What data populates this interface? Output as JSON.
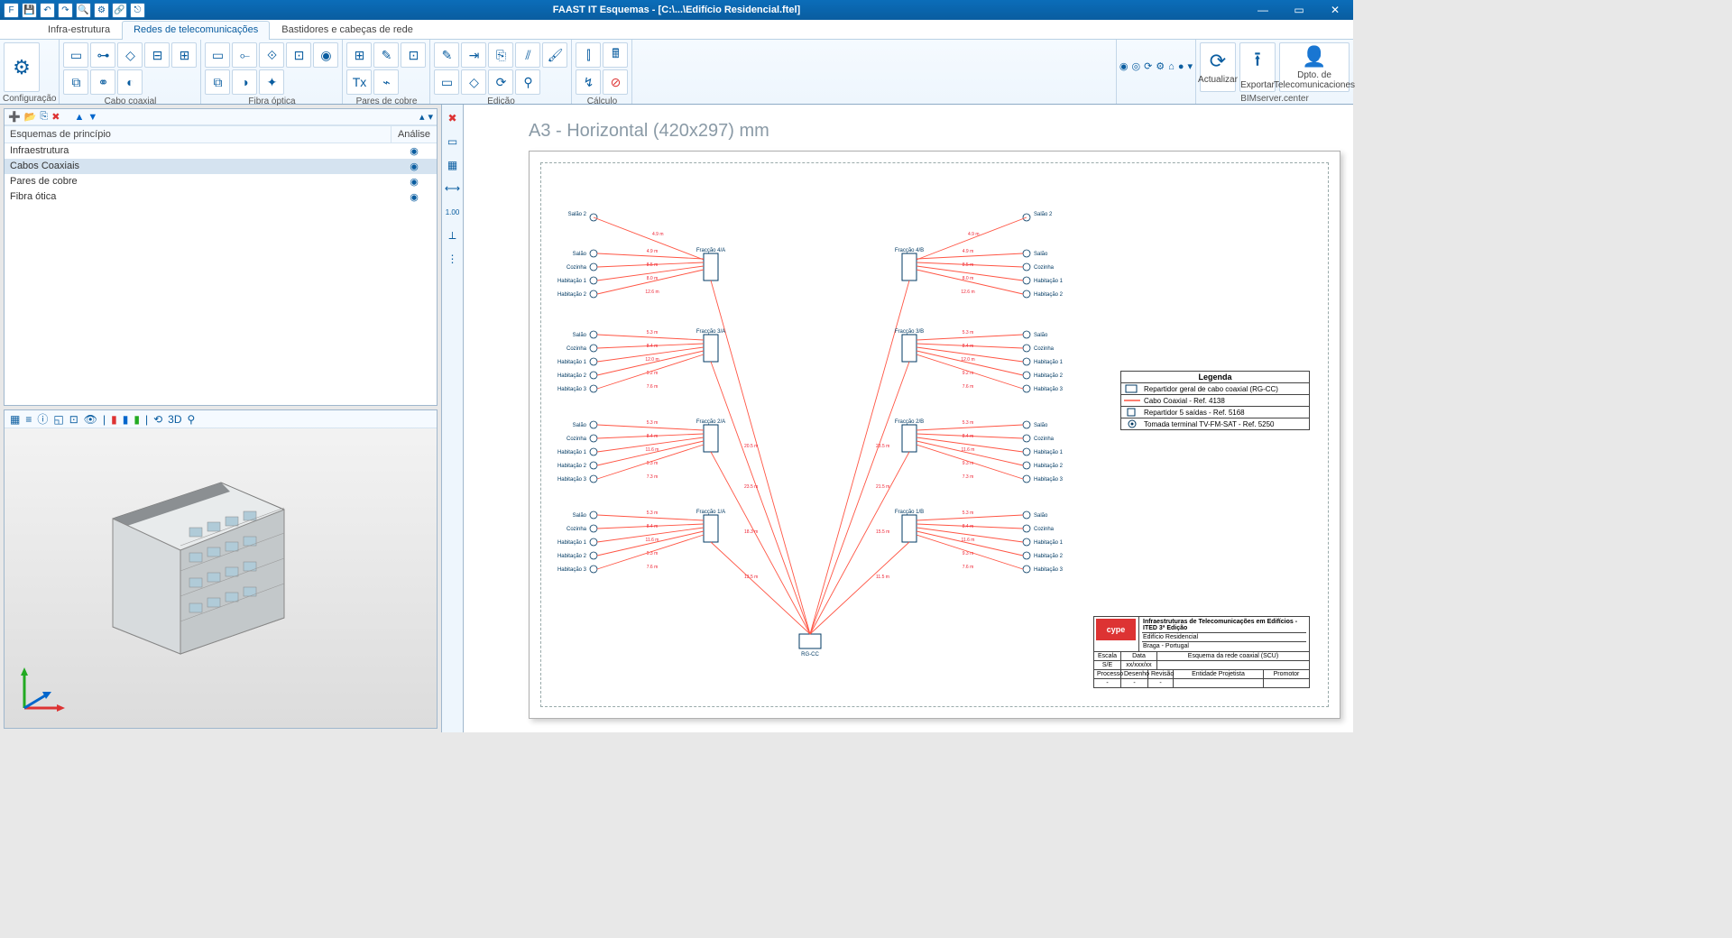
{
  "app": {
    "title": "FAAST IT Esquemas - [C:\\...\\Edifício Residencial.ftel]"
  },
  "tabs": {
    "t1": "Infra-estrutura",
    "t2": "Redes de telecomunicações",
    "t3": "Bastidores e cabeças de rede"
  },
  "ribbon": {
    "g0": "Configuração",
    "g1": "Cabo coaxial",
    "g2": "Fibra óptica",
    "g3": "Pares de cobre",
    "g4": "Edição",
    "g5": "Cálculo",
    "g6_a": "Actualizar",
    "g6_b": "Exportar",
    "g6_c": "Dpto. de\nTelecomunicaciones",
    "g6": "BIMserver.center"
  },
  "list": {
    "hdr1": "Esquemas de princípio",
    "hdr2": "Análise",
    "r0": "Infraestrutura",
    "r1": "Cabos Coaxiais",
    "r2": "Pares de cobre",
    "r3": "Fibra ótica"
  },
  "canvas": {
    "title": "A3 - Horizontal (420x297) mm"
  },
  "legend": {
    "hdr": "Legenda",
    "r0": "Repartidor geral de cabo coaxial (RG-CC)",
    "r1": "Cabo Coaxial - Ref. 4138",
    "r2": "Repartidor 5 saídas - Ref. 5168",
    "r3": "Tomada terminal TV-FM-SAT - Ref. 5250"
  },
  "tblock": {
    "t0": "Infraestruturas de Telecomunicações em Edifícios - ITED 3ª Edição",
    "t1": "Edifício Residencial",
    "t2": "Braga - Portugal",
    "c_escala": "Escala",
    "c_data": "Data",
    "c_se": "S/E",
    "c_date": "xx/xxx/xx",
    "c_proc": "Processo",
    "c_des": "Desenho",
    "c_rev": "Revisão",
    "c_sch": "Esquema da rede coaxial (SCU)",
    "c_ent": "Entidade Projetista",
    "c_prom": "Promotor"
  },
  "sch": {
    "rgcc": "RG-CC",
    "flabels": [
      "Fracção 4/A",
      "Fracção 4/B",
      "Fracção 3/A",
      "Fracção 3/B",
      "Fracção 2/A",
      "Fracção 2/B",
      "Fracção 1/A",
      "Fracção 1/B"
    ],
    "rooms_top": [
      "Salão",
      "Cozinha",
      "Habitação 1",
      "Habitação 2"
    ],
    "rooms": [
      "Salão",
      "Cozinha",
      "Habitação 1",
      "Habitação 2",
      "Habitação 3"
    ],
    "extra": "Salão 2",
    "dist4": [
      "4.9 m",
      "8.5 m",
      "8.0 m",
      "12.6 m"
    ],
    "dist3": [
      "5.3 m",
      "8.4 m",
      "12.0 m",
      "9.2 m",
      "7.6 m"
    ],
    "dist2": [
      "5.3 m",
      "8.4 m",
      "11.6 m",
      "9.3 m",
      "7.3 m"
    ],
    "dist1": [
      "5.3 m",
      "8.4 m",
      "11.6 m",
      "9.3 m",
      "7.6 m"
    ],
    "trunk": [
      "20.5 m",
      "23.5 m",
      "23.5 m",
      "21.5 m",
      "18.3 m",
      "15.5 m",
      "13.5 m",
      "11.5 m"
    ],
    "extradist": "4.9 m"
  }
}
